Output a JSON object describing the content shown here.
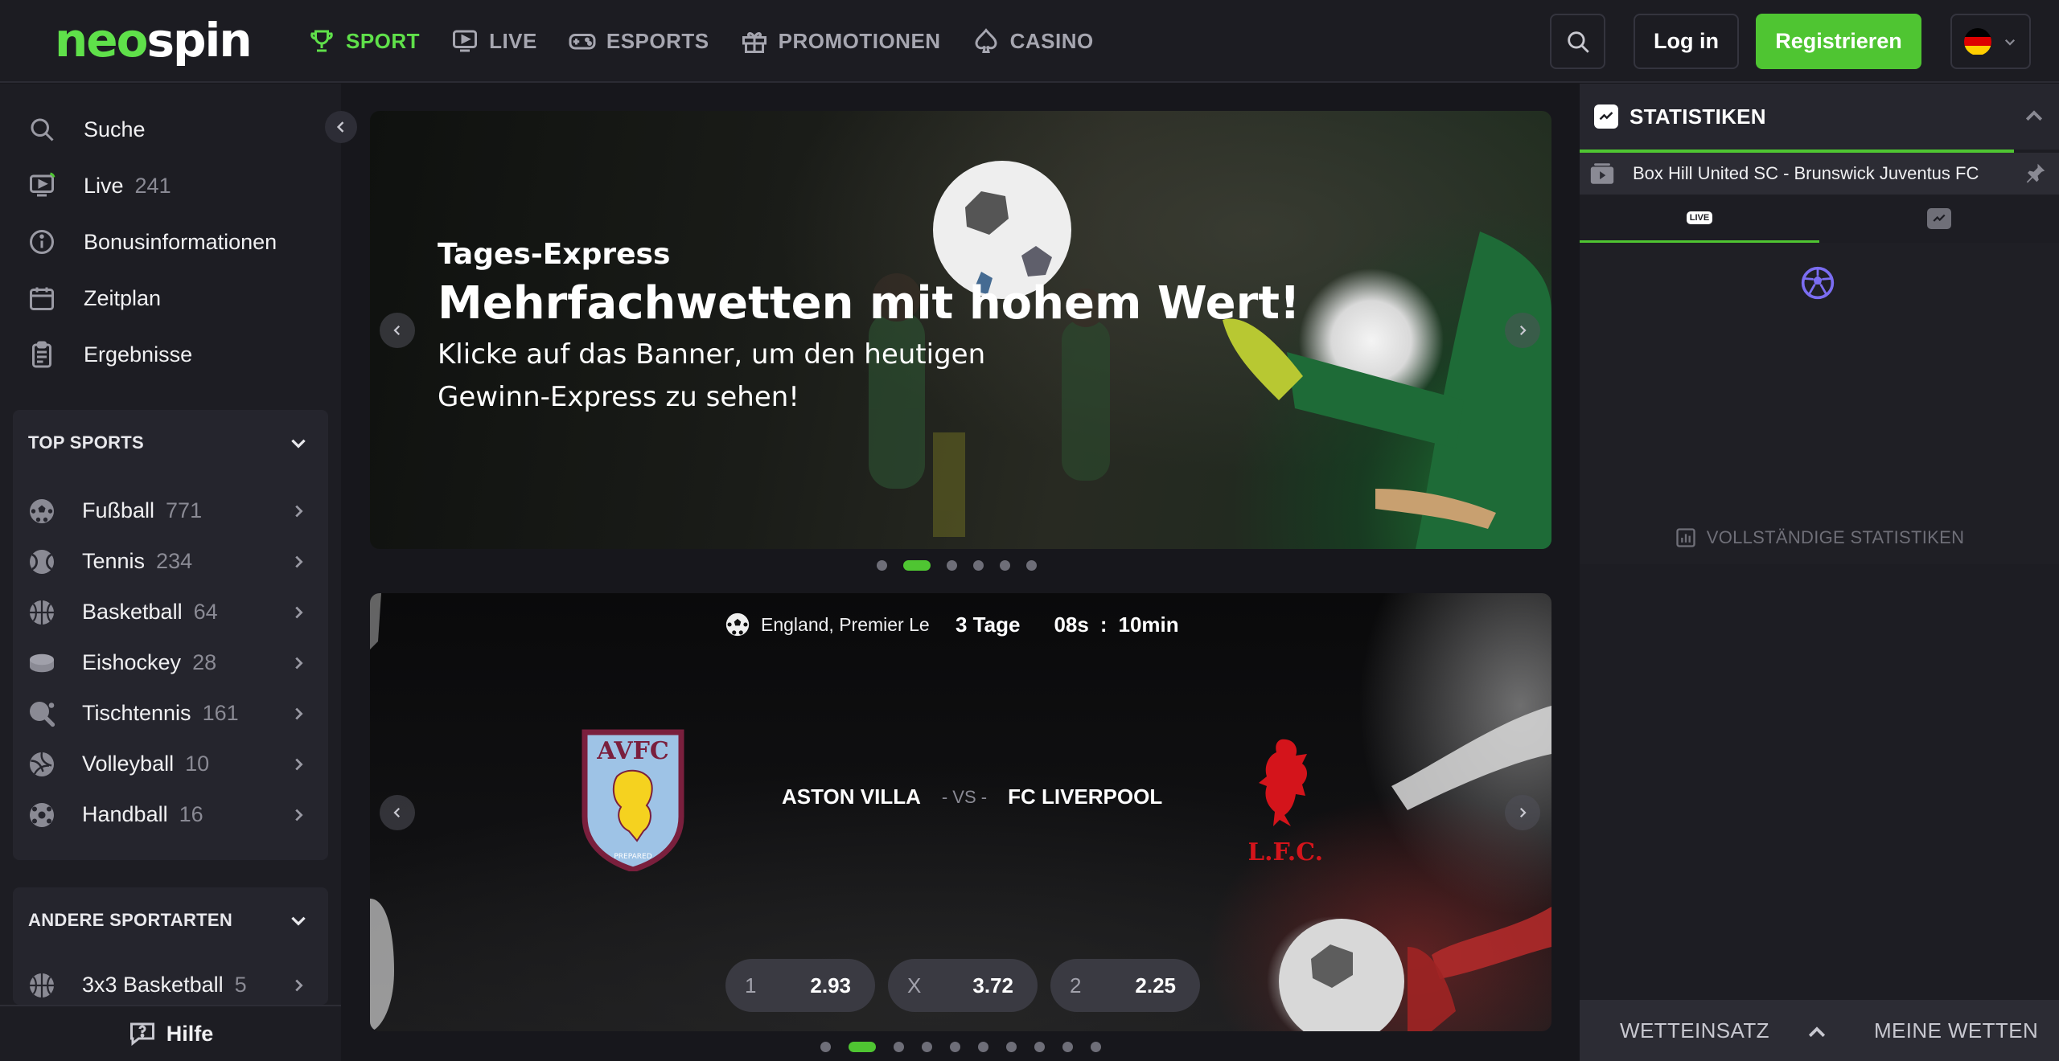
{
  "header": {
    "logo_neo": "neo",
    "logo_spin": "spin",
    "nav": [
      {
        "label": "SPORT",
        "icon": "trophy-icon",
        "active": true
      },
      {
        "label": "LIVE",
        "icon": "live-tv-icon",
        "active": false
      },
      {
        "label": "ESPORTS",
        "icon": "gamepad-icon",
        "active": false
      },
      {
        "label": "PROMOTIONEN",
        "icon": "gift-icon",
        "active": false
      },
      {
        "label": "CASINO",
        "icon": "spade-icon",
        "active": false
      }
    ],
    "login_label": "Log in",
    "register_label": "Registrieren",
    "language_flag": "germany-flag"
  },
  "sidebar": {
    "menu": [
      {
        "label": "Suche",
        "icon": "search-icon"
      },
      {
        "label": "Live",
        "count": "241",
        "icon": "live-tv-icon"
      },
      {
        "label": "Bonusinformationen",
        "icon": "info-icon"
      },
      {
        "label": "Zeitplan",
        "icon": "calendar-icon"
      },
      {
        "label": "Ergebnisse",
        "icon": "clipboard-icon"
      }
    ],
    "top_sports_title": "TOP SPORTS",
    "top_sports": [
      {
        "label": "Fußball",
        "count": "771",
        "icon": "soccer-ball-icon"
      },
      {
        "label": "Tennis",
        "count": "234",
        "icon": "tennis-ball-icon"
      },
      {
        "label": "Basketball",
        "count": "64",
        "icon": "basketball-icon"
      },
      {
        "label": "Eishockey",
        "count": "28",
        "icon": "hockey-puck-icon"
      },
      {
        "label": "Tischtennis",
        "count": "161",
        "icon": "table-tennis-icon"
      },
      {
        "label": "Volleyball",
        "count": "10",
        "icon": "volleyball-icon"
      },
      {
        "label": "Handball",
        "count": "16",
        "icon": "handball-icon"
      }
    ],
    "other_sports_title": "ANDERE SPORTARTEN",
    "other_sports": [
      {
        "label": "3x3 Basketball",
        "count": "5",
        "icon": "basketball-icon"
      }
    ],
    "help_label": "Hilfe"
  },
  "banner": {
    "kicker": "Tages-Express",
    "title": "Mehrfachwetten mit hohem Wert!",
    "subtitle": "Klicke auf das Banner, um den heutigen Gewinn-Express zu sehen!",
    "dots_total": 6,
    "dots_active_index": 1
  },
  "match": {
    "league": "England, Premier League",
    "countdown_days": "3 Tage",
    "countdown_seconds": "08s",
    "countdown_separator": ":",
    "countdown_minutes": "10min",
    "home_team": "ASTON VILLA",
    "vs": "- VS -",
    "away_team": "FC LIVERPOOL",
    "odds": [
      {
        "label": "1",
        "value": "2.93"
      },
      {
        "label": "X",
        "value": "3.72"
      },
      {
        "label": "2",
        "value": "2.25"
      }
    ],
    "dots_total": 10,
    "dots_active_index": 1
  },
  "stats": {
    "title": "STATISTIKEN",
    "match_name": "Box Hill United SC - Brunswick Juventus FC",
    "tab_live_badge": "LIVE",
    "full_stats_label": "VOLLSTÄNDIGE STATISTIKEN"
  },
  "betslip": {
    "stake_label": "WETTEINSATZ",
    "my_bets_label": "MEINE WETTEN"
  },
  "colors": {
    "accent_green": "#4fc532",
    "logo_green": "#5fe04a",
    "background": "#17171c",
    "panel": "#25252d"
  }
}
